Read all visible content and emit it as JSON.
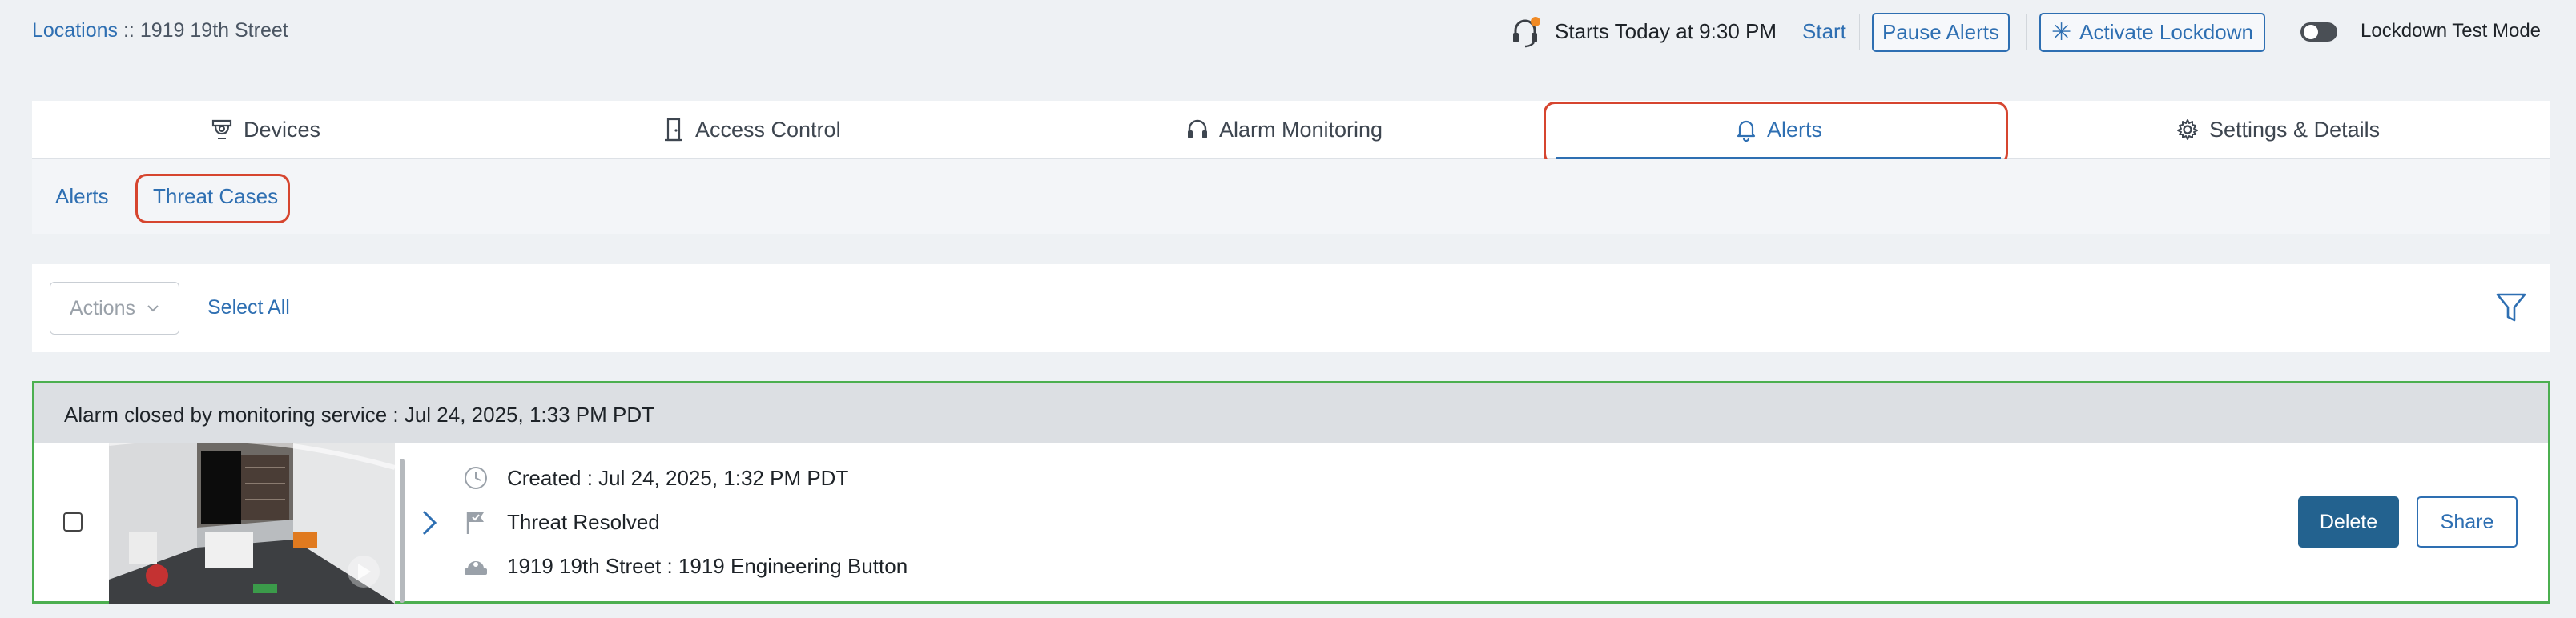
{
  "header": {
    "breadcrumb_link": "Locations",
    "breadcrumb_sep": " :: ",
    "breadcrumb_current": "1919 19th Street",
    "schedule_text": "Starts Today at 9:30 PM",
    "start_label": "Start",
    "pause_alerts_label": "Pause Alerts",
    "activate_lockdown_label": "Activate Lockdown",
    "lockdown_test_mode_label": "Lockdown Test Mode",
    "lockdown_test_mode_on": false
  },
  "tabs": [
    {
      "label": "Devices",
      "icon": "camera-icon"
    },
    {
      "label": "Access Control",
      "icon": "door-icon"
    },
    {
      "label": "Alarm Monitoring",
      "icon": "headset-icon"
    },
    {
      "label": "Alerts",
      "icon": "bell-icon",
      "active": true
    },
    {
      "label": "Settings & Details",
      "icon": "gear-icon"
    }
  ],
  "subtabs": [
    {
      "label": "Alerts"
    },
    {
      "label": "Threat Cases",
      "active": true
    }
  ],
  "actions": {
    "select_label": "Actions",
    "select_all_label": "Select All"
  },
  "alarm": {
    "header": "Alarm closed by monitoring service : Jul 24, 2025, 1:33 PM PDT",
    "created": "Created : Jul 24, 2025, 1:32 PM PDT",
    "status": "Threat Resolved",
    "location": "1919 19th Street : 1919 Engineering Button",
    "delete_label": "Delete",
    "share_label": "Share"
  },
  "colors": {
    "accent": "#2e6fb2",
    "highlight": "#d6452f",
    "resolved_border": "#4caf50",
    "delete_bg": "#23628f"
  }
}
